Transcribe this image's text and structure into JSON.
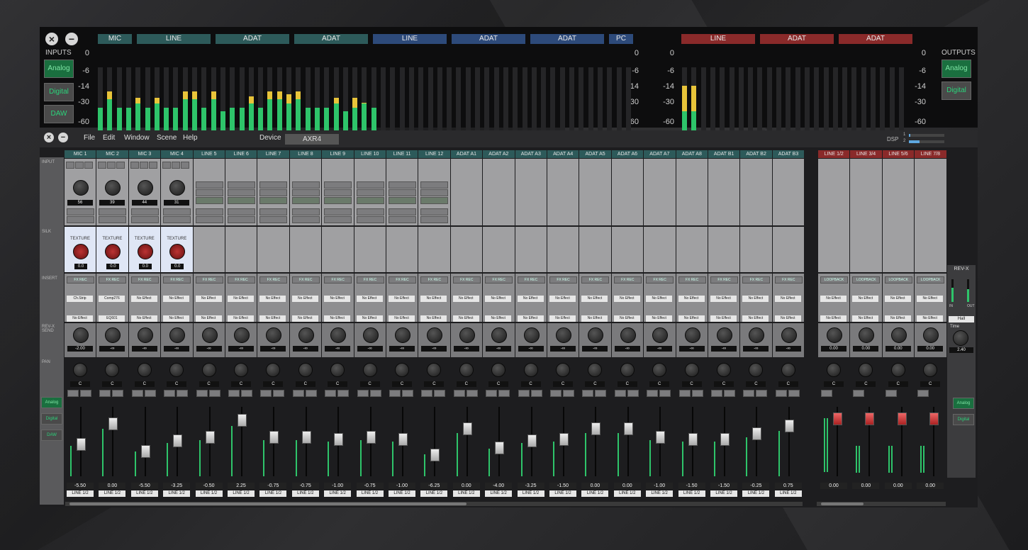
{
  "meters_window": {
    "inputs_label": "INPUTS",
    "outputs_label": "OUTPUTS",
    "input_buttons": [
      "Analog",
      "Digital",
      "DAW"
    ],
    "output_buttons": [
      "Analog",
      "Digital"
    ],
    "scale": [
      "0",
      "-6",
      "-14",
      "-30",
      "-60"
    ],
    "input_groups": [
      "MIC",
      "LINE",
      "ADAT",
      "ADAT",
      "LINE",
      "ADAT",
      "ADAT",
      "PC"
    ],
    "output_groups": [
      "LINE",
      "ADAT",
      "ADAT"
    ]
  },
  "mixer": {
    "menu": [
      "File",
      "Edit",
      "Window",
      "Scene",
      "Help"
    ],
    "device_label": "Device",
    "device_value": "AXR4",
    "dsp_label": "DSP",
    "dsp_rows": [
      "1",
      "2"
    ],
    "section_labels": [
      "INPUT",
      "SILK",
      "INSERT",
      "REV-X SEND",
      "PAN"
    ],
    "channels": [
      "MIC 1",
      "MIC 2",
      "MIC 3",
      "MIC 4",
      "LINE 5",
      "LINE 6",
      "LINE 7",
      "LINE 8",
      "LINE 9",
      "LINE 10",
      "LINE 11",
      "LINE 12",
      "ADAT A1",
      "ADAT A2",
      "ADAT A3",
      "ADAT A4",
      "ADAT A5",
      "ADAT A6",
      "ADAT A7",
      "ADAT A8",
      "ADAT B1",
      "ADAT B2",
      "ADAT B3"
    ],
    "outputs": [
      "LINE 1/2",
      "LINE 3/4",
      "LINE 5/6",
      "LINE 7/8"
    ],
    "mic_gain": [
      "56",
      "39",
      "44",
      "31"
    ],
    "silk_label": "TEXTURE",
    "silk_values": [
      "0.0",
      "0.0",
      "0.0",
      "0.0"
    ],
    "insert_top": [
      "FX REC",
      "LOOPBACK"
    ],
    "insert_effects_1": [
      "Ch.Strip",
      "Comp276",
      "No Effect"
    ],
    "insert_effects_2": [
      "No Effect",
      "EQ601",
      "No Effect"
    ],
    "rev_send": [
      "-2.00",
      "-∞"
    ],
    "out_rev_send": [
      "0.00",
      "0.00",
      "0.00",
      "0.00"
    ],
    "revx": {
      "title": "REV-X",
      "type": "Hall",
      "time_label": "Time",
      "time_value": "2.40",
      "in": "IN",
      "out": "OUT"
    },
    "pan": "C",
    "fader_values": [
      "-5.50",
      "0.00",
      "-5.50",
      "-3.25",
      "-0.50",
      "2.25",
      "-0.75",
      "-0.75",
      "-1.00",
      "-0.75",
      "-1.00",
      "-6.25",
      "0.00",
      "-4.00",
      "-3.25",
      "-1.50",
      "0.00",
      "0.00",
      "-1.00",
      "-1.50",
      "-1.50",
      "-0.25",
      "0.75"
    ],
    "fader_levels": [
      0.55,
      0.85,
      0.45,
      0.6,
      0.65,
      0.9,
      0.65,
      0.65,
      0.62,
      0.65,
      0.62,
      0.4,
      0.78,
      0.5,
      0.6,
      0.62,
      0.78,
      0.78,
      0.65,
      0.62,
      0.62,
      0.7,
      0.82
    ],
    "out_fader_values": [
      "0.00",
      "0.00",
      "0.00",
      "0.00"
    ],
    "route": "LINE 1/2",
    "side_buttons": [
      "Analog",
      "Digital",
      "DAW"
    ],
    "out_side_buttons": [
      "Analog",
      "Digital"
    ]
  },
  "colors": {
    "mic_header": "#2d5a5a",
    "out_header": "#8a2a2a",
    "meter_green": "#2ec46a",
    "meter_yellow": "#e8c43a"
  }
}
